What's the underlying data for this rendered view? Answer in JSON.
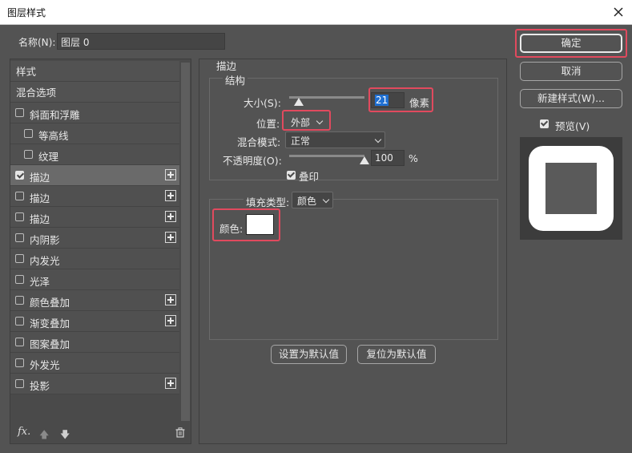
{
  "window": {
    "title": "图层样式"
  },
  "name_field": {
    "label": "名称(N):",
    "value": "图层 0"
  },
  "styles_list": {
    "header_styles": "样式",
    "header_blending": "混合选项",
    "items": [
      {
        "label": "斜面和浮雕",
        "checked": false,
        "has_plus": false,
        "sub": false
      },
      {
        "label": "等高线",
        "checked": false,
        "has_plus": false,
        "sub": true
      },
      {
        "label": "纹理",
        "checked": false,
        "has_plus": false,
        "sub": true
      },
      {
        "label": "描边",
        "checked": true,
        "has_plus": true,
        "sub": false,
        "selected": true
      },
      {
        "label": "描边",
        "checked": false,
        "has_plus": true,
        "sub": false
      },
      {
        "label": "描边",
        "checked": false,
        "has_plus": true,
        "sub": false
      },
      {
        "label": "内阴影",
        "checked": false,
        "has_plus": true,
        "sub": false
      },
      {
        "label": "内发光",
        "checked": false,
        "has_plus": false,
        "sub": false
      },
      {
        "label": "光泽",
        "checked": false,
        "has_plus": false,
        "sub": false
      },
      {
        "label": "颜色叠加",
        "checked": false,
        "has_plus": true,
        "sub": false
      },
      {
        "label": "渐变叠加",
        "checked": false,
        "has_plus": true,
        "sub": false
      },
      {
        "label": "图案叠加",
        "checked": false,
        "has_plus": false,
        "sub": false
      },
      {
        "label": "外发光",
        "checked": false,
        "has_plus": false,
        "sub": false
      },
      {
        "label": "投影",
        "checked": false,
        "has_plus": true,
        "sub": false
      }
    ],
    "fx_label": "fx."
  },
  "stroke": {
    "section_title": "描边",
    "structure_title": "结构",
    "size_label": "大小(S):",
    "size_value": "21",
    "size_unit": "像素",
    "position_label": "位置:",
    "position_value": "外部",
    "blend_label": "混合模式:",
    "blend_value": "正常",
    "opacity_label": "不透明度(O):",
    "opacity_value": "100",
    "opacity_unit": "%",
    "overprint_label": "叠印",
    "fill_type_label": "填充类型:",
    "fill_type_value": "颜色",
    "color_label": "颜色:",
    "color_value": "#ffffff",
    "set_default_button": "设置为默认值",
    "reset_default_button": "复位为默认值"
  },
  "buttons": {
    "ok": "确定",
    "cancel": "取消",
    "new_style": "新建样式(W)..."
  },
  "preview": {
    "label": "预览(V)",
    "checked": true
  }
}
